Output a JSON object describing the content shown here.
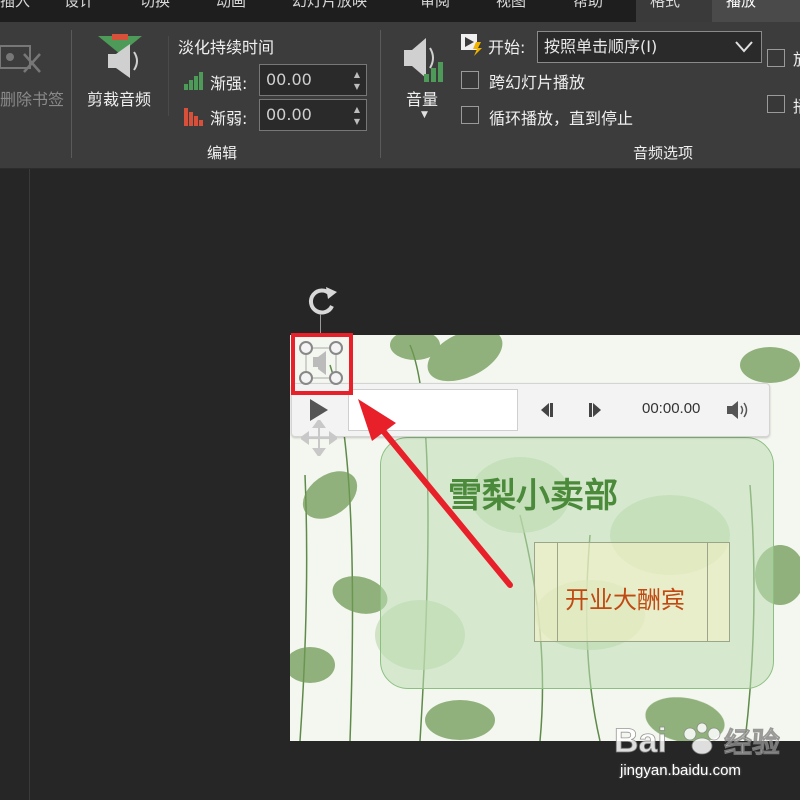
{
  "tabs": [
    {
      "label": "插入"
    },
    {
      "label": "设计"
    },
    {
      "label": "切换"
    },
    {
      "label": "动画"
    },
    {
      "label": "幻灯片放映"
    },
    {
      "label": "审阅"
    },
    {
      "label": "视图"
    },
    {
      "label": "帮助"
    },
    {
      "label": "格式"
    },
    {
      "label": "播放"
    }
  ],
  "ribbon": {
    "remove_bookmark_label": "删除书签",
    "trim_audio_label": "剪裁音频",
    "fade_duration_label": "淡化持续时间",
    "fade_in_label": "渐强:",
    "fade_in_value": "00.00",
    "fade_out_label": "渐弱:",
    "fade_out_value": "00.00",
    "edit_group_label": "编辑",
    "volume_label": "音量",
    "start_label": "开始:",
    "start_value": "按照单击顺序(I)",
    "play_across_slides_label": "跨幻灯片播放",
    "loop_label": "循环播放，直到停止",
    "audio_options_group_label": "音频选项",
    "right_cut_label_1": "放",
    "right_cut_label_2": "播"
  },
  "slide": {
    "title": "雪梨小卖部",
    "subtitle": "开业大酬宾"
  },
  "player": {
    "time": "00:00.00"
  },
  "watermark": {
    "url": "jingyan.baidu.com"
  },
  "colors": {
    "ribbon_bg": "#3c3c3c",
    "workspace_bg": "#262626",
    "highlight": "#e8202a",
    "title_green": "#4a8a3a",
    "subtitle_orange": "#c04a12"
  }
}
